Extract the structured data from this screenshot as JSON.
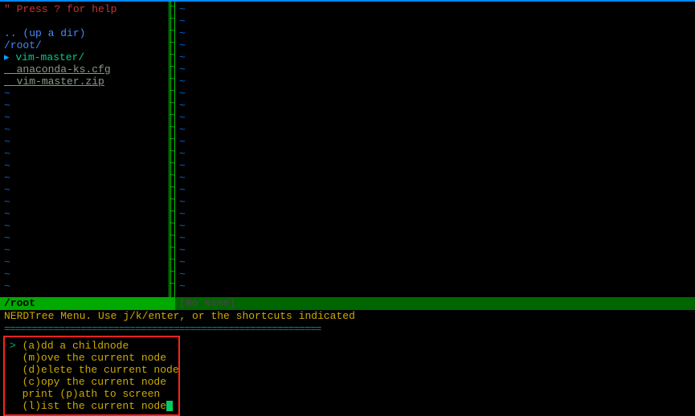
{
  "nerdtree": {
    "help": "\" Press ? for help",
    "updir": ".. (up a dir)",
    "root": "/root/",
    "marker": "▸",
    "folder": "vim-master/",
    "files": [
      "anaconda-ks.cfg",
      "vim-master.zip"
    ],
    "tilde": "~"
  },
  "right_pane": {
    "tilde": "~"
  },
  "status": {
    "left": "/root",
    "right": "[No Name]"
  },
  "menu": {
    "prompt": "NERDTree Menu. Use j/k/enter, or the shortcuts indicated",
    "separator": "==========================================================",
    "marker": ">",
    "items": [
      "(a)dd a childnode",
      "(m)ove the current node",
      "(d)elete the current node",
      "(c)opy the current node",
      "print (p)ath to screen",
      "(l)ist the current node"
    ]
  }
}
